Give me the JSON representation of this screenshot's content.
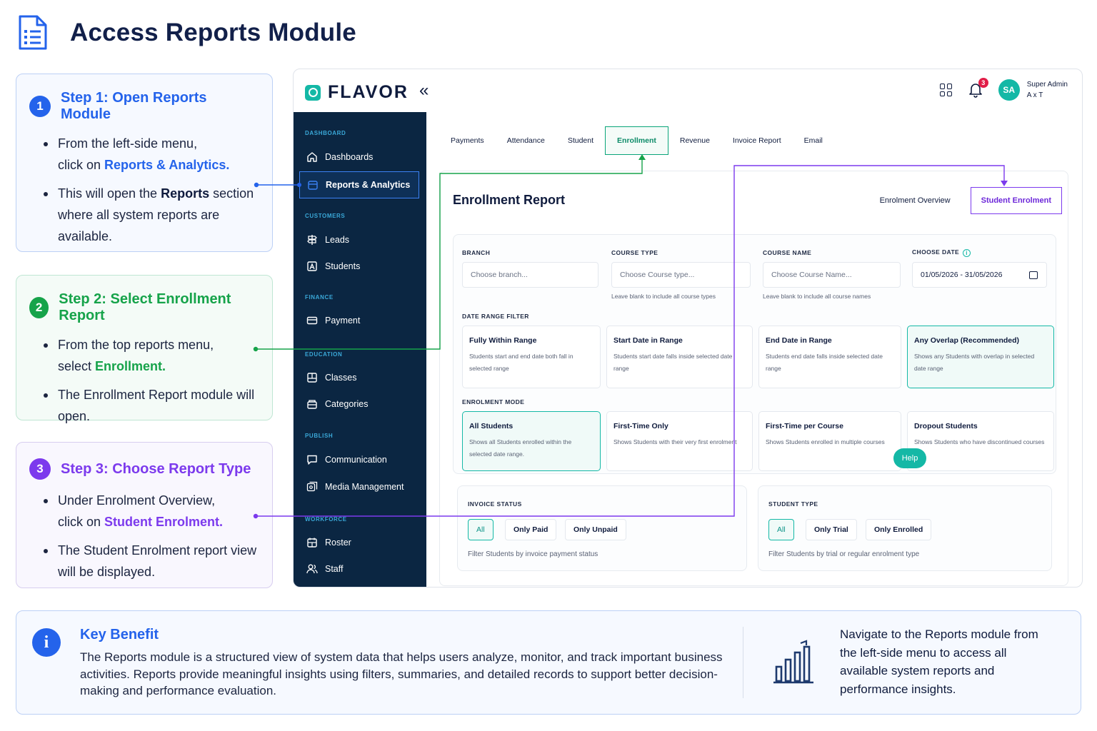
{
  "page": {
    "title": "Access Reports Module"
  },
  "steps": [
    {
      "num": "1",
      "title": "Step 1: Open Reports Module",
      "b1_pre": "From the left-side menu,",
      "b1_pre2": "click on ",
      "b1_hl": "Reports & Analytics",
      "b1_post": ".",
      "b2_pre": "This will open the ",
      "b2_hl": "Reports",
      "b2_post": "section where all system reports are available."
    },
    {
      "num": "2",
      "title": "Step 2: Select Enrollment Report",
      "b1_pre": "From the top reports menu,",
      "b1_pre2": "select ",
      "b1_hl": "Enrollment",
      "b1_post": ".",
      "b2_text": "The Enrollment Report module will open."
    },
    {
      "num": "3",
      "title": "Step 3: Choose Report Type",
      "b1_pre": "Under Enrolment Overview,",
      "b1_pre2": "click on ",
      "b1_hl": "Student Enrolment",
      "b1_post": ".",
      "b2_text": "The Student Enrolment report view will be displayed."
    }
  ],
  "app": {
    "brand": "FLAVOR",
    "collapse_icon": "double-chevron-left-icon",
    "notification_count": "3",
    "avatar_initials": "SA",
    "user_role": "Super Admin",
    "user_name": "A x T",
    "sidebar": {
      "dashboard_section": "DASHBOARD",
      "customers_section": "CUSTOMERS",
      "finance_section": "FINANCE",
      "education_section": "EDUCATION",
      "publish_section": "PUBLISH",
      "workforce_section": "WORKFORCE",
      "items": {
        "dashboards": "Dashboards",
        "reports": "Reports & Analytics",
        "leads": "Leads",
        "students": "Students",
        "payment": "Payment",
        "classes": "Classes",
        "categories": "Categories",
        "communication": "Communication",
        "media": "Media Management",
        "roster": "Roster",
        "staff": "Staff"
      }
    },
    "tabs": [
      "Payments",
      "Attendance",
      "Student",
      "Enrollment",
      "Revenue",
      "Invoice Report",
      "Email"
    ],
    "active_tab": "Enrollment",
    "report": {
      "title": "Enrollment Report",
      "overview_tab": "Enrolment Overview",
      "student_tab": "Student Enrolment",
      "branch_label": "BRANCH",
      "branch_placeholder": "Choose branch...",
      "course_type_label": "COURSE TYPE",
      "course_type_placeholder": "Choose Course type...",
      "course_type_hint": "Leave blank to include all course types",
      "course_name_label": "COURSE NAME",
      "course_name_placeholder": "Choose Course Name...",
      "course_name_hint": "Leave blank to include all course names",
      "date_label": "CHOOSE DATE",
      "date_value": "01/05/2026 - 31/05/2026",
      "date_range_label": "DATE RANGE FILTER",
      "date_options": [
        {
          "title": "Fully Within Range",
          "desc": "Students start and end date both fall in selected range"
        },
        {
          "title": "Start Date in Range",
          "desc": "Students start date falls inside selected date range"
        },
        {
          "title": "End Date in Range",
          "desc": "Students end date falls inside selected date range"
        },
        {
          "title": "Any Overlap (Recommended)",
          "desc": "Shows any Students with overlap in selected date range"
        }
      ],
      "mode_label": "ENROLMENT MODE",
      "mode_options": [
        {
          "title": "All Students",
          "desc": "Shows all Students enrolled within the selected date range."
        },
        {
          "title": "First-Time Only",
          "desc": "Shows Students with their very first enrolment"
        },
        {
          "title": "First-Time per Course",
          "desc": "Shows Students enrolled in multiple courses"
        },
        {
          "title": "Dropout Students",
          "desc": "Shows Students who have discontinued courses"
        }
      ],
      "invoice_label": "INVOICE STATUS",
      "invoice_chips": [
        "All",
        "Only Paid",
        "Only Unpaid"
      ],
      "invoice_hint": "Filter Students by invoice payment status",
      "student_type_label": "STUDENT TYPE",
      "student_type_chips": [
        "All",
        "Only Trial",
        "Only Enrolled"
      ],
      "student_type_hint": "Filter Students by trial or regular enrolment type",
      "help": "Help"
    }
  },
  "benefit": {
    "title": "Key Benefit",
    "text": "The Reports module is a structured view of system data that helps users analyze, monitor, and track important business activities. Reports provide meaningful insights using filters, summaries, and detailed records to support better decision-making and performance evaluation.",
    "side_text": "Navigate to the Reports module from the left-side menu to access all available system reports and performance insights."
  },
  "colors": {
    "step1": "#2463eb",
    "step2": "#16a34a",
    "step3": "#7c3aed",
    "sidebar_bg": "#0b2642",
    "accent": "#14b8a6"
  }
}
